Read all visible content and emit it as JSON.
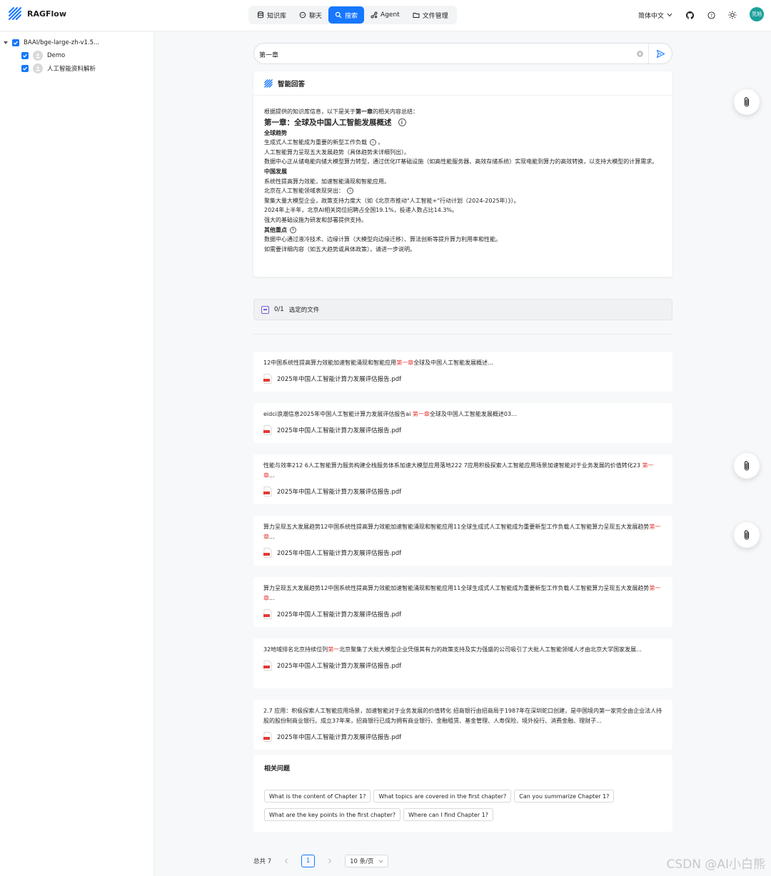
{
  "app": {
    "name": "RAGFlow",
    "accent": "#1677ff"
  },
  "nav": [
    {
      "label": "知识库",
      "icon": "database-icon"
    },
    {
      "label": "聊天",
      "icon": "chat-icon"
    },
    {
      "label": "搜索",
      "icon": "search-icon",
      "active": true
    },
    {
      "label": "Agent",
      "icon": "agent-icon"
    },
    {
      "label": "文件管理",
      "icon": "folder-icon"
    }
  ],
  "header": {
    "language": "简体中文",
    "avatar_text": "亮旭"
  },
  "sidebar": {
    "model": "BAAI/bge-large-zh-v1.5...",
    "knowledge_bases": [
      {
        "label": "Demo",
        "checked": true
      },
      {
        "label": "人工智能资料解析",
        "checked": true
      }
    ]
  },
  "search": {
    "value": "第一章"
  },
  "answer": {
    "title": "智能回答",
    "intro_prefix": "根据提供的知识库信息，以下是关于",
    "intro_bold": "第一章",
    "intro_suffix": "的相关内容总结：",
    "heading": "第一章：全球及中国人工智能发展概述",
    "sec1_title": "全球趋势",
    "sec1_l1": "生成式人工智能成为重要的新型工作负载",
    "sec1_l1_tail": "。",
    "sec1_l2": "人工智能算力呈现五大发展趋势（具体趋势未详细列出）。",
    "sec1_l3": "数据中心正从储电能向储大模型算力转型，通过优化IT基础设施（如高性能服务器、高效存储系统）实现电能到算力的高效转换，以支持大模型的计算需求。",
    "sec2_title": "中国发展",
    "sec2_l1": "系统性提高算力效能，加速智能涌现和智能应用。",
    "sec2_l2": "北京在人工智能领域表现突出：",
    "sec2_l3": "聚集大量大模型企业，政策支持力度大（如《北京市推动\"人工智能+\"行动计划（2024-2025年）》）。",
    "sec2_l4": "2024年上半年，北京AI相关岗位招聘占全国19.1%，投递人数占比14.3%。",
    "sec2_l5": "强大的基础设施为研发和部署提供支持。",
    "sec3_title": "其他重点",
    "sec3_l1": "数据中心通过液冷技术、边缘计算（大模型向边缘迁移）、算法创新等提升算力利用率和性能。",
    "closing": "如需要详细内容（如五大趋势或具体政策），请进一步说明。"
  },
  "filter": {
    "count": "0/1",
    "label": "选定的文件"
  },
  "results": [
    {
      "pre": "12中国系统性提高算力效能加速智能涌现和智能应用",
      "hl": "第一章",
      "post": "全球及中国人工智能发展概述...",
      "file": "2025年中国人工智能计算力发展评估报告.pdf"
    },
    {
      "pre": "eidci浪潮信息2025年中国人工智能计算力发展评估报告ai ",
      "hl": "第一章",
      "post": "全球及中国人工智能发展概述03...",
      "file": "2025年中国人工智能计算力发展评估报告.pdf"
    },
    {
      "pre": "性能与效率212 6人工智能算力服务构建全栈服务体系加速大模型应用落地222 7应用积极探索人工智能应用场景加速智能对于业务发展的价值转化23 ",
      "hl": "第一章",
      "post": "...",
      "file": "2025年中国人工智能计算力发展评估报告.pdf"
    },
    {
      "pre": "算力呈现五大发展趋势12中国系统性提高算力效能加速智能涌现和智能应用11全球生成式人工智能成为重要新型工作负载人工智能算力呈现五大发展趋势",
      "hl": "第一章",
      "post": "...",
      "file": "2025年中国人工智能计算力发展评估报告.pdf"
    },
    {
      "pre": "算力呈现五大发展趋势12中国系统性提高算力效能加速智能涌现和智能应用11全球生成式人工智能成为重要新型工作负载人工智能算力呈现五大发展趋势",
      "hl": "第一章",
      "post": "...",
      "file": "2025年中国人工智能计算力发展评估报告.pdf"
    },
    {
      "pre": "32地域排名北京持续位列",
      "hl": "第一",
      "post": "北京聚集了大批大模型企业凭借其有力的政策支持及实力强盛的公司吸引了大批人工智能领域人才由北京大学国家发展...",
      "file": "2025年中国人工智能计算力发展评估报告.pdf"
    },
    {
      "pre": "2.7 应用：积极探索人工智能应用场景，加速智能对于业务发展的价值转化 招商银行由招商局于1987年在深圳蛇口创建，是中国境内第一家完全由企业法人持股的股份制商业银行。成立37年来，招商银行已成为拥有商业银行、金融租赁、基金管理、人寿保险、境外投行、消费金融、理财子...",
      "hl": "",
      "post": "",
      "file": "2025年中国人工智能计算力发展评估报告.pdf"
    }
  ],
  "related": {
    "title": "相关问题",
    "questions": [
      "What is the content of Chapter 1?",
      "What topics are covered in the first chapter?",
      "Can you summarize Chapter 1?",
      "What are the key points in the first chapter?",
      "Where can I find Chapter 1?"
    ]
  },
  "pagination": {
    "total": "总共 7",
    "current": "1",
    "page_size": "10 条/页"
  },
  "watermark": "CSDN @AI小白熊"
}
